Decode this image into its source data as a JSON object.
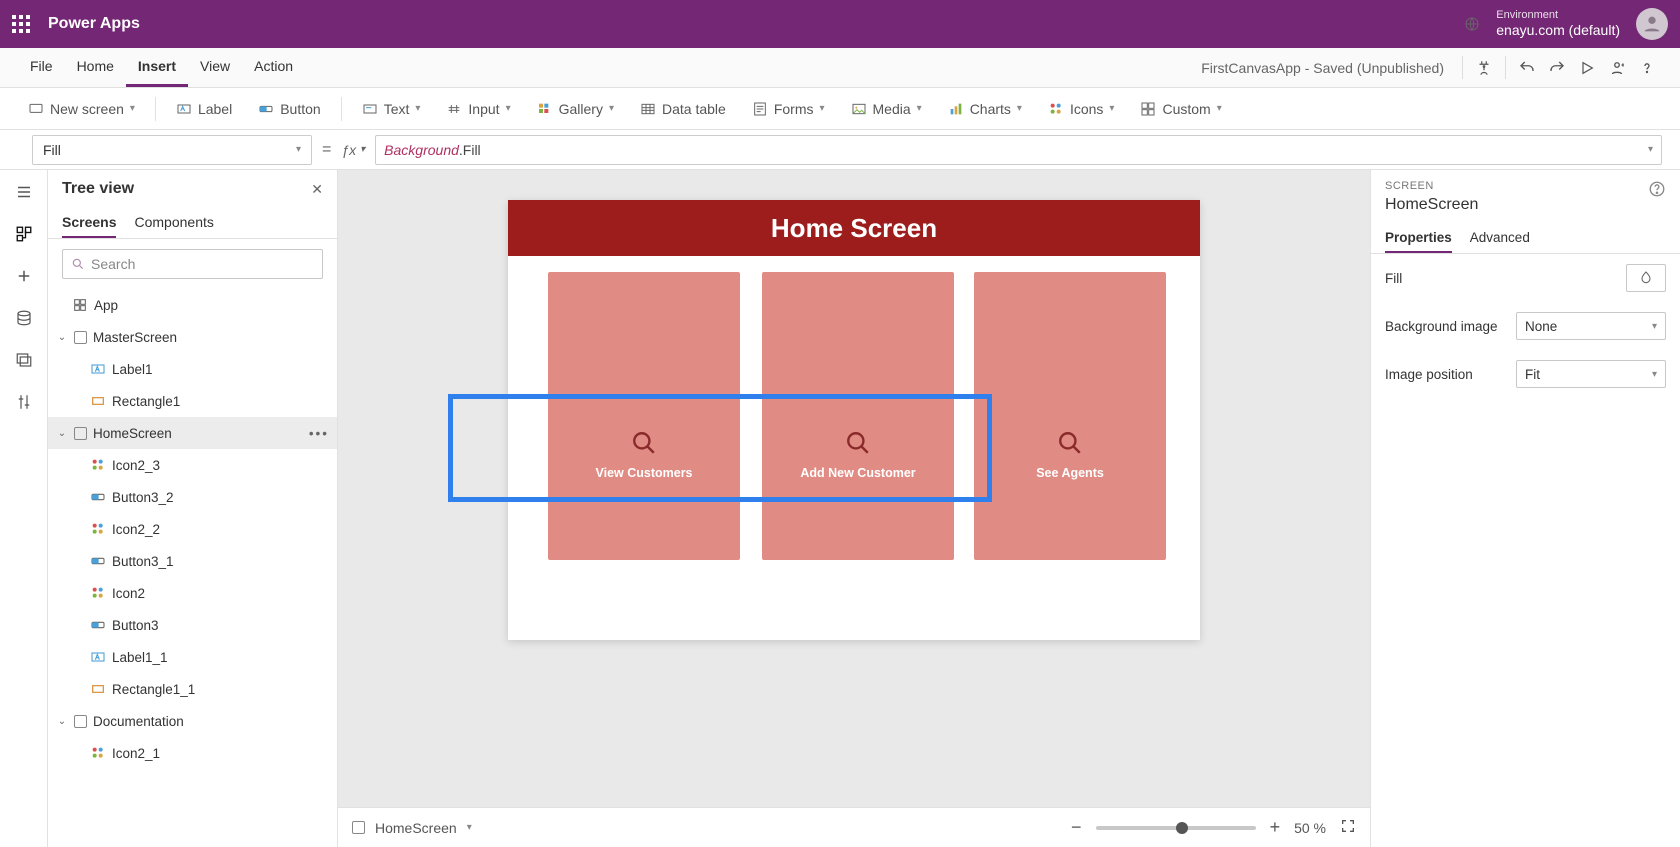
{
  "brand": "Power Apps",
  "environment": {
    "label": "Environment",
    "value": "enayu.com (default)"
  },
  "menus": {
    "file": "File",
    "home": "Home",
    "insert": "Insert",
    "view": "View",
    "action": "Action"
  },
  "doc_title": "FirstCanvasApp - Saved (Unpublished)",
  "ribbon": {
    "new_screen": "New screen",
    "label": "Label",
    "button": "Button",
    "text": "Text",
    "input": "Input",
    "gallery": "Gallery",
    "data_table": "Data table",
    "forms": "Forms",
    "media": "Media",
    "charts": "Charts",
    "icons": "Icons",
    "custom": "Custom"
  },
  "formula": {
    "property": "Fill",
    "value_obj": "Background",
    "value_prop": ".Fill"
  },
  "tree": {
    "title": "Tree view",
    "tabs": {
      "screens": "Screens",
      "components": "Components"
    },
    "search_placeholder": "Search",
    "nodes": {
      "app": "App",
      "master": "MasterScreen",
      "label1": "Label1",
      "rect1": "Rectangle1",
      "home": "HomeScreen",
      "icon2_3": "Icon2_3",
      "button3_2": "Button3_2",
      "icon2_2": "Icon2_2",
      "button3_1": "Button3_1",
      "icon2": "Icon2",
      "button3": "Button3",
      "label1_1": "Label1_1",
      "rect1_1": "Rectangle1_1",
      "doc": "Documentation",
      "icon2_1": "Icon2_1"
    }
  },
  "canvas": {
    "header": "Home Screen",
    "tiles": {
      "t1": "View Customers",
      "t2": "Add New Customer",
      "t3": "See Agents"
    }
  },
  "canvas_footer": {
    "screen": "HomeScreen",
    "zoom": "50 %"
  },
  "props": {
    "category": "SCREEN",
    "name": "HomeScreen",
    "tabs": {
      "properties": "Properties",
      "advanced": "Advanced"
    },
    "fill": "Fill",
    "bgimage_label": "Background image",
    "bgimage_value": "None",
    "imgpos_label": "Image position",
    "imgpos_value": "Fit"
  }
}
